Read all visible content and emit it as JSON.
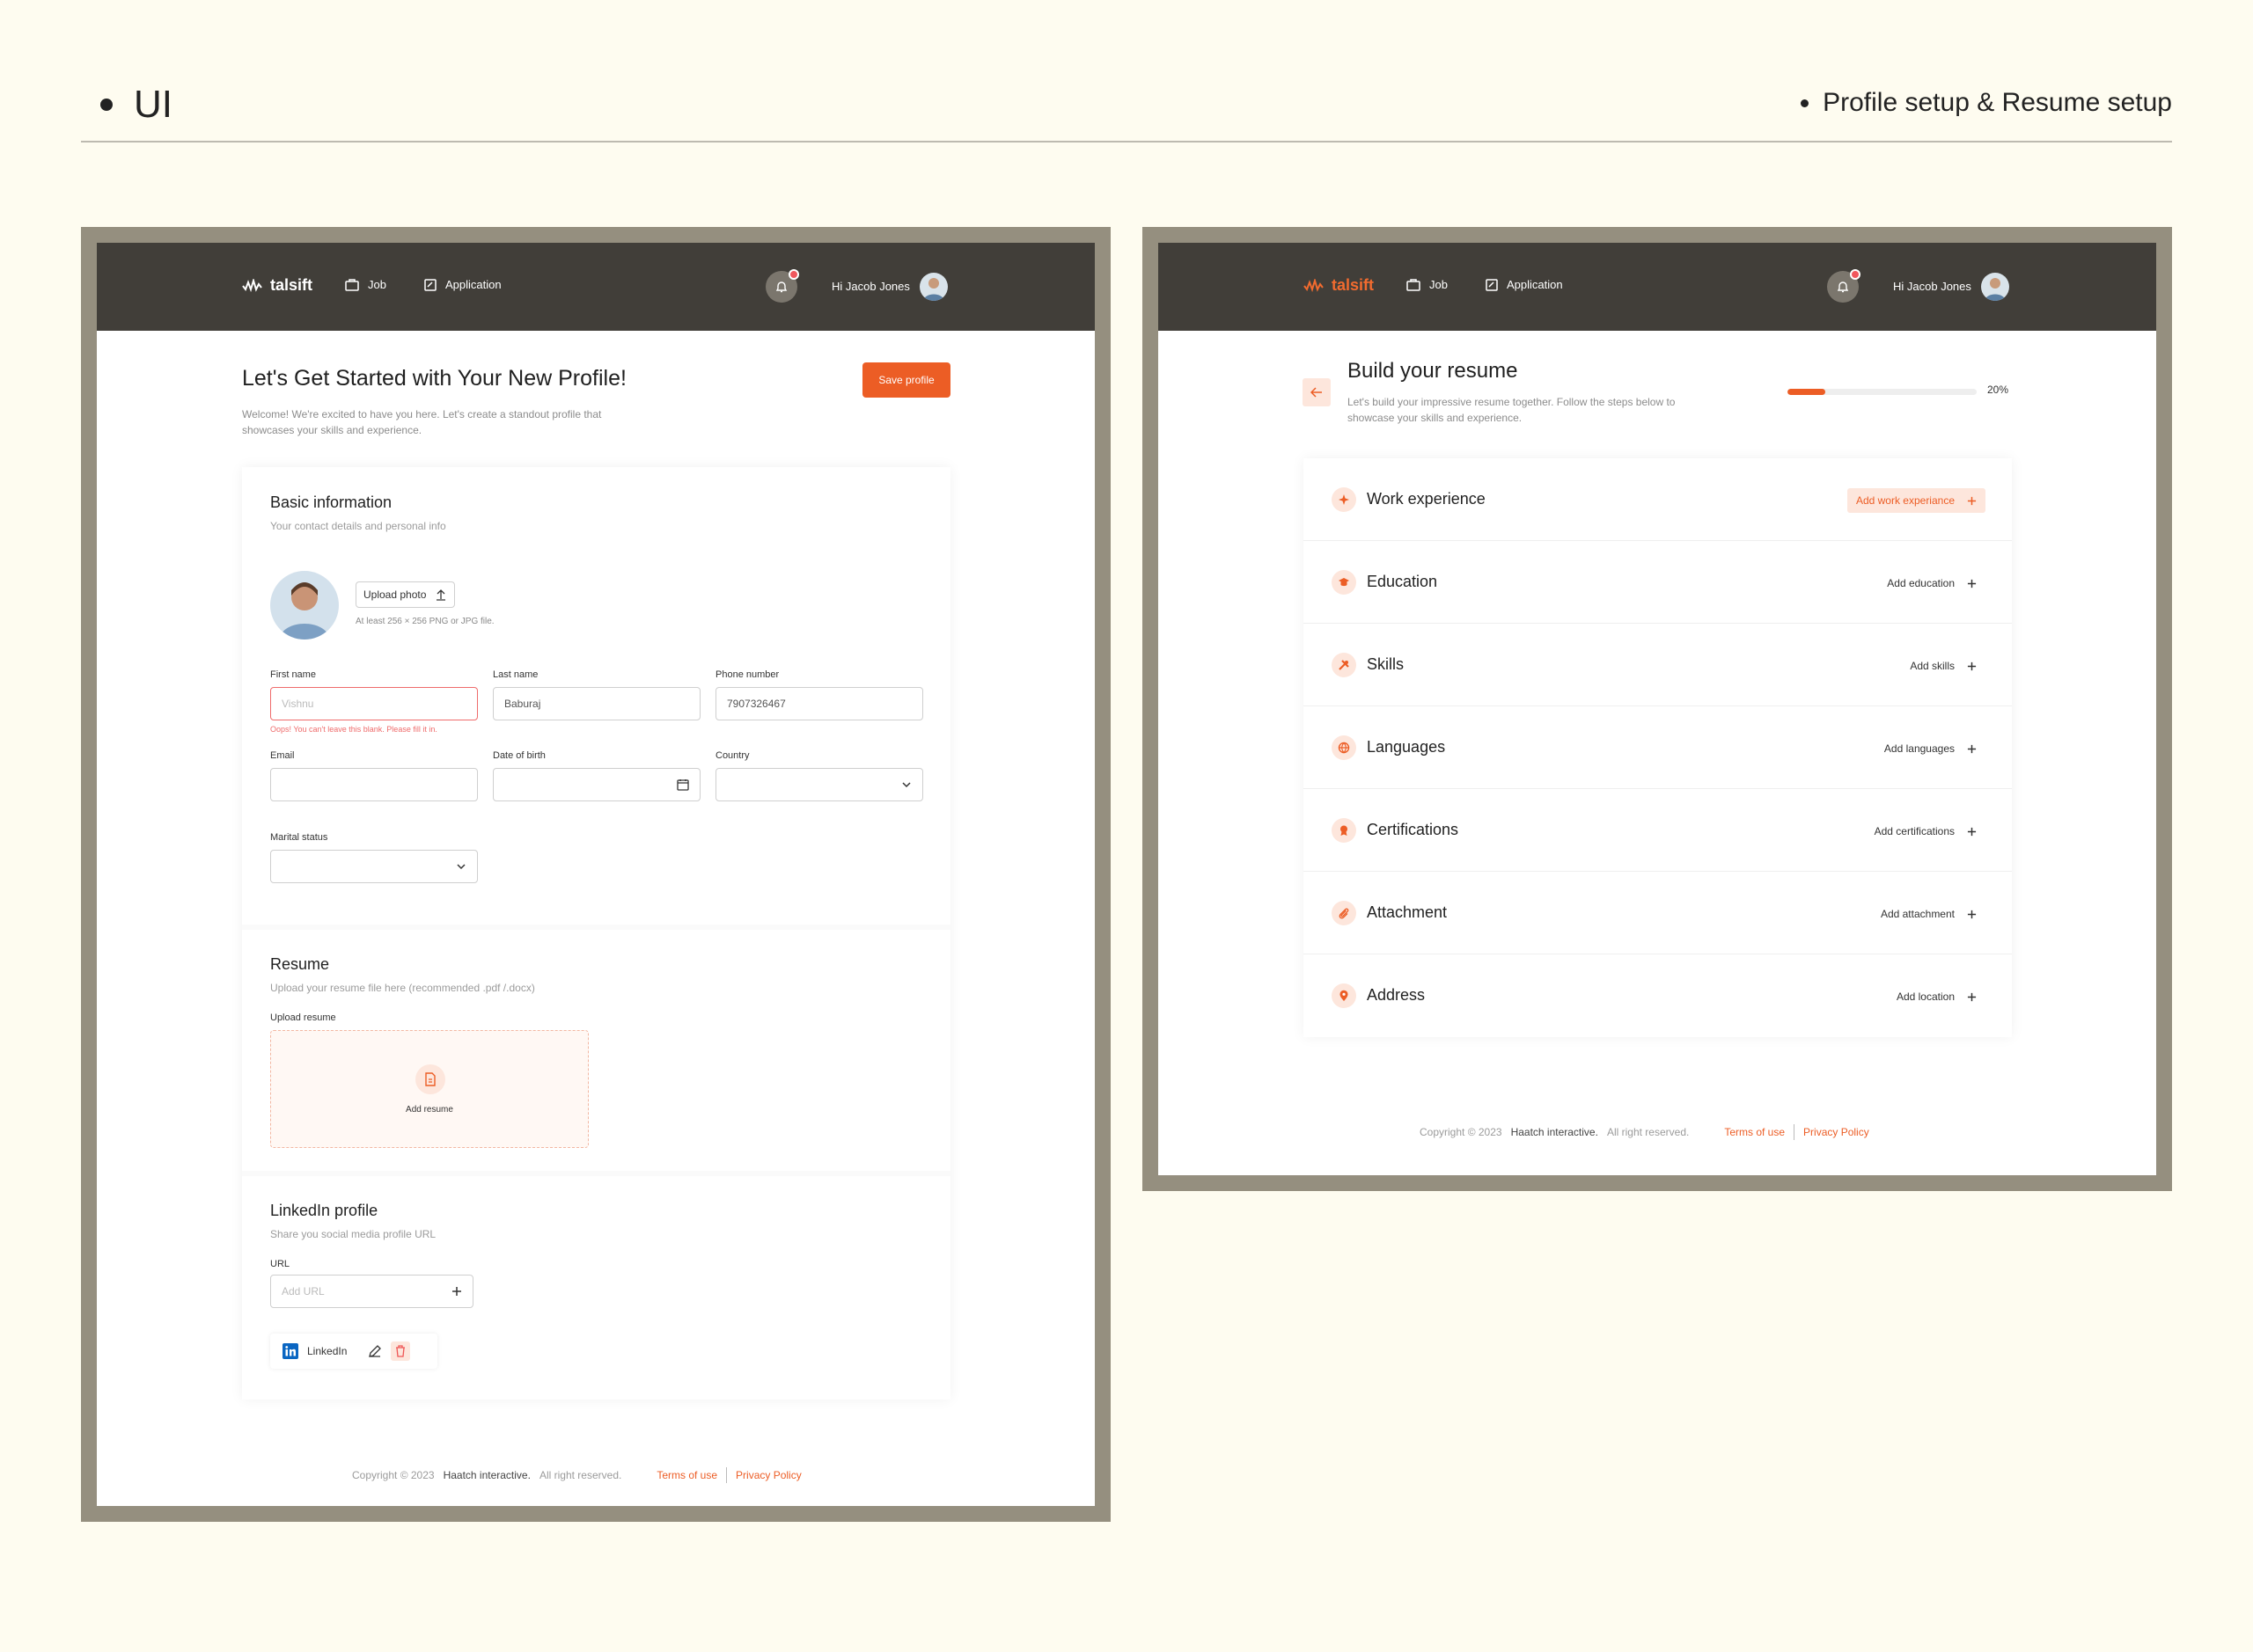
{
  "page": {
    "left_title": "UI",
    "right_title": "Profile setup & Resume setup"
  },
  "nav": {
    "logo": "talsift",
    "job": "Job",
    "application": "Application",
    "greeting": "Hi Jacob Jones"
  },
  "profile": {
    "title": "Let's Get Started with Your New Profile!",
    "subtitle_line1": "Welcome! We're excited to have you here. Let's create a standout profile that",
    "subtitle_line2": "showcases your skills and experience.",
    "save_button": "Save profile",
    "basic": {
      "title": "Basic information",
      "subtitle": "Your contact details and personal info",
      "upload_photo": "Upload photo",
      "photo_hint": "At least 256 × 256 PNG or JPG file.",
      "first_name_label": "First name",
      "first_name_placeholder": "Vishnu",
      "first_name_error": "Oops! You can't leave this blank. Please fill it in.",
      "last_name_label": "Last name",
      "last_name_value": "Baburaj",
      "phone_label": "Phone number",
      "phone_value": "7907326467",
      "email_label": "Email",
      "dob_label": "Date of birth",
      "country_label": "Country",
      "marital_label": "Marital status"
    },
    "resume": {
      "title": "Resume",
      "subtitle": "Upload your resume file here (recommended .pdf /.docx)",
      "upload_label": "Upload resume",
      "add_resume": "Add resume"
    },
    "linkedin": {
      "title": "LinkedIn profile",
      "subtitle": "Share you social media profile URL",
      "url_label": "URL",
      "url_placeholder": "Add URL",
      "chip_label": "LinkedIn"
    }
  },
  "resume_builder": {
    "title": "Build your resume",
    "subtitle_line1": "Let's build your impressive resume together. Follow the steps below to",
    "subtitle_line2": "showcase your skills and experience.",
    "progress_percent": 20,
    "progress_text": "20%",
    "sections": [
      {
        "label": "Work experience",
        "action": "Add work experiance",
        "icon": "sparkle-icon"
      },
      {
        "label": "Education",
        "action": "Add education",
        "icon": "graduation-cap-icon"
      },
      {
        "label": "Skills",
        "action": "Add skills",
        "icon": "tools-icon"
      },
      {
        "label": "Languages",
        "action": "Add languages",
        "icon": "globe-icon"
      },
      {
        "label": "Certifications",
        "action": "Add certifications",
        "icon": "award-icon"
      },
      {
        "label": "Attachment",
        "action": "Add attachment",
        "icon": "paperclip-icon"
      },
      {
        "label": "Address",
        "action": "Add location",
        "icon": "location-pin-icon"
      }
    ]
  },
  "footer": {
    "copyright": "Copyright © 2023",
    "company": "Haatch interactive.",
    "rights": "All right reserved.",
    "terms": "Terms of use",
    "privacy": "Privacy Policy"
  },
  "colors": {
    "accent": "#ec5d25",
    "navbar": "#413e39",
    "frame": "#958f7f",
    "background": "#fefcf0"
  }
}
